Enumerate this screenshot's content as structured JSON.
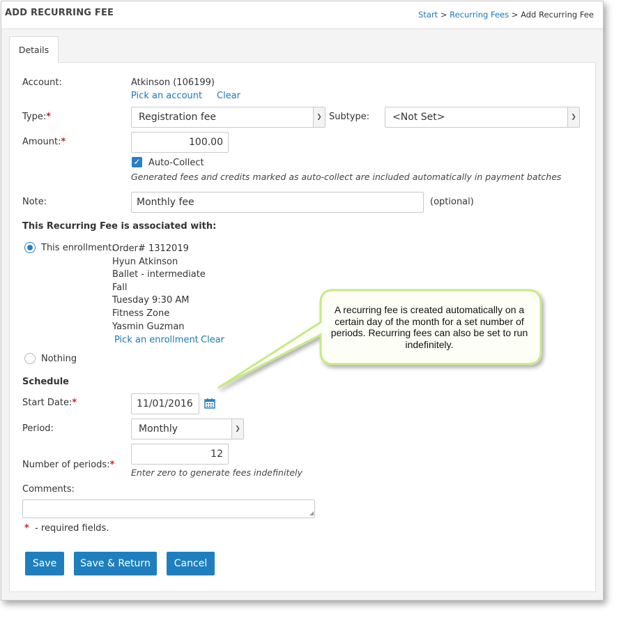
{
  "header": {
    "title": "ADD RECURRING FEE",
    "breadcrumb": {
      "start": "Start",
      "sep1": " > ",
      "recurring_fees": "Recurring Fees",
      "sep2": " > ",
      "current": "Add Recurring Fee"
    }
  },
  "tabs": [
    {
      "label": "Details",
      "active": true
    }
  ],
  "form": {
    "account": {
      "label": "Account:",
      "value": "Atkinson (106199)",
      "pick_link": "Pick an account",
      "clear_link": "Clear"
    },
    "type": {
      "label": "Type:",
      "value": "Registration fee",
      "required": "*"
    },
    "subtype": {
      "label": "Subtype:",
      "value": "<Not Set>"
    },
    "amount": {
      "label": "Amount:",
      "value": "100.00",
      "required": "*"
    },
    "auto_collect": {
      "label": "Auto-Collect",
      "checked": true,
      "hint": "Generated fees and credits marked as auto-collect are included automatically in payment batches"
    },
    "note": {
      "label": "Note:",
      "value": "Monthly fee",
      "optional": "(optional)"
    },
    "association": {
      "heading": "This Recurring Fee is associated with:",
      "enrollment_label": "This enrollment:",
      "enrollment_selected": true,
      "enrollment_lines": [
        "Order# 1312019",
        "Hyun Atkinson",
        "Ballet - intermediate",
        "Fall",
        "Tuesday 9:30 AM",
        "Fitness Zone",
        "Yasmin Guzman"
      ],
      "pick_link": "Pick an enrollment",
      "clear_link": "Clear",
      "nothing_label": "Nothing"
    },
    "schedule": {
      "heading": "Schedule",
      "start_date": {
        "label": "Start Date:",
        "value": "11/01/2016",
        "required": "*"
      },
      "period": {
        "label": "Period:",
        "value": "Monthly"
      },
      "num_periods": {
        "label": "Number of periods:",
        "value": "12",
        "required": "*",
        "hint": "Enter zero to generate fees indefinitely"
      }
    },
    "comments": {
      "label": "Comments:",
      "value": ""
    },
    "required_note": {
      "star": "*",
      "text": "- required fields."
    }
  },
  "buttons": {
    "save": "Save",
    "save_return": "Save & Return",
    "cancel": "Cancel"
  },
  "callout": {
    "text": "A recurring fee is created automatically on a certain day of the month for a set number of periods. Recurring fees can also be set to run indefinitely."
  },
  "colors": {
    "accent": "#1f7fbe",
    "link": "#1a78b8",
    "required": "#cc2222",
    "callout_fill": "#fdfef6",
    "callout_border": "#c7e98a"
  }
}
